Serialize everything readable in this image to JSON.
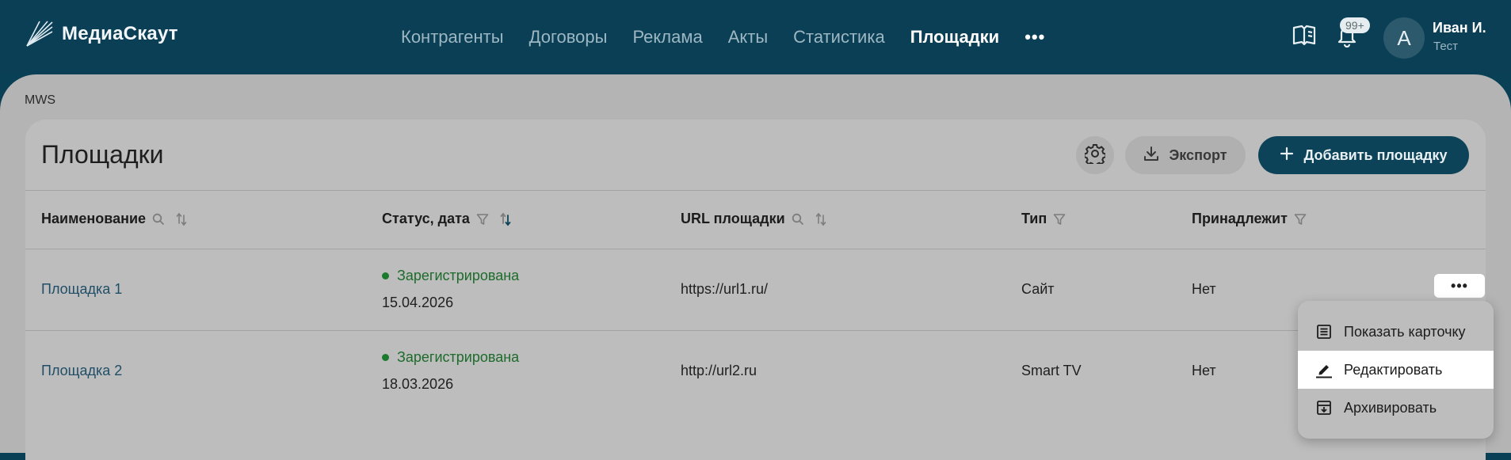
{
  "app": {
    "logo_text": "МедиаСкаут"
  },
  "nav": {
    "items": [
      "Контрагенты",
      "Договоры",
      "Реклама",
      "Акты",
      "Статистика",
      "Площадки"
    ],
    "active": "Площадки",
    "more_label": "•••"
  },
  "header": {
    "notifications_badge": "99+",
    "avatar_initial": "А",
    "user_name": "Иван И.",
    "user_sub": "Тест"
  },
  "breadcrumb": "MWS",
  "page": {
    "title": "Площадки",
    "export_label": "Экспорт",
    "add_label": "Добавить площадку"
  },
  "table": {
    "columns": [
      "Наименование",
      "Статус, дата",
      "URL площадки",
      "Тип",
      "Принадлежит"
    ],
    "rows": [
      {
        "name": "Площадка 1",
        "status": "Зарегистрирована",
        "date": "15.04.2026",
        "url": "https://url1.ru/",
        "type": "Сайт",
        "owner": "Нет"
      },
      {
        "name": "Площадка 2",
        "status": "Зарегистрирована",
        "date": "18.03.2026",
        "url": "http://url2.ru",
        "type": "Smart TV",
        "owner": "Нет"
      }
    ],
    "row_menu_label": "•••"
  },
  "context_menu": {
    "items": [
      "Показать карточку",
      "Редактировать",
      "Архивировать"
    ],
    "highlighted": "Редактировать"
  },
  "colors": {
    "header_bg": "#0a3f55",
    "primary_button": "#0c4358",
    "status_ok": "#1d6b2a",
    "link": "#1f4e66"
  },
  "icons": {
    "logo": "radiating-lines-icon",
    "docs": "book-icon",
    "notifications": "bell-icon",
    "settings": "gear-icon",
    "export": "download-icon",
    "add": "plus-icon",
    "search": "search-icon",
    "sort": "sort-icon",
    "filter": "filter-icon",
    "show_card": "card-icon",
    "edit": "edit-icon",
    "archive": "archive-icon"
  }
}
